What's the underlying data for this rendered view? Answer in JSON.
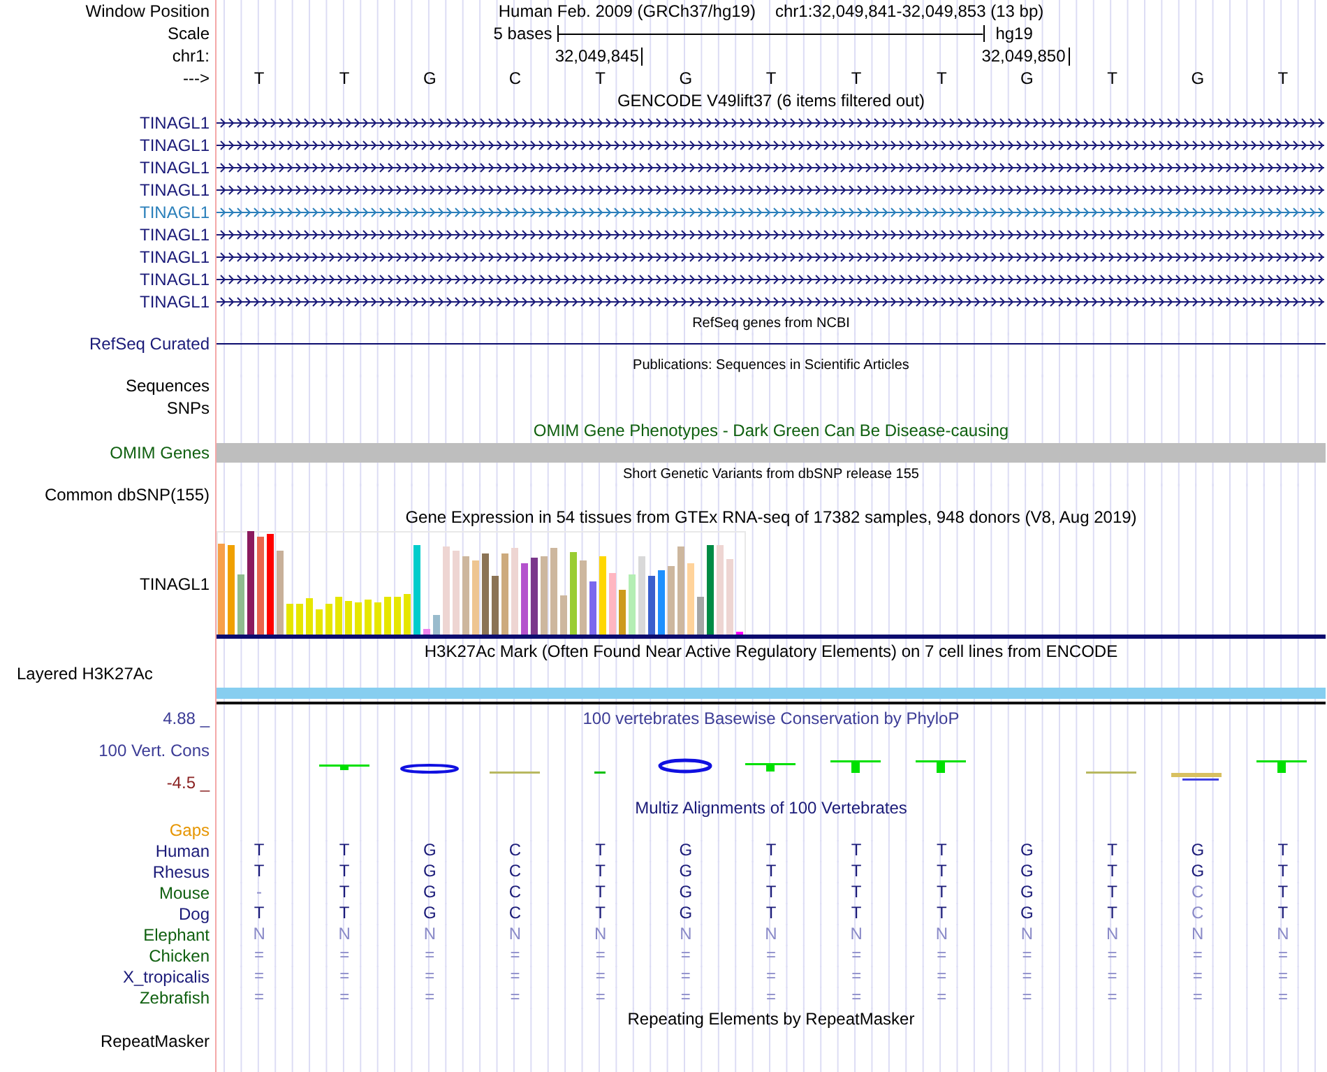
{
  "header": {
    "position_label": "Window Position",
    "assembly": "Human Feb. 2009 (GRCh37/hg19)",
    "range": "chr1:32,049,841-32,049,853 (13 bp)",
    "scale_label": "Scale",
    "scale_text": "5 bases",
    "scale_db": "hg19",
    "chrom_label": "chr1:",
    "ticks": [
      "32,049,845",
      "32,049,850"
    ],
    "strand_label": "--->",
    "bases": [
      "T",
      "T",
      "G",
      "C",
      "T",
      "G",
      "T",
      "T",
      "T",
      "G",
      "T",
      "G",
      "T"
    ]
  },
  "tracks": [
    {
      "kind": "gene",
      "title": "GENCODE V49lift37 (6 items filtered out)",
      "items": [
        {
          "label": "TINAGL1",
          "color": "#1a1a78"
        },
        {
          "label": "TINAGL1",
          "color": "#1a1a78"
        },
        {
          "label": "TINAGL1",
          "color": "#1a1a78"
        },
        {
          "label": "TINAGL1",
          "color": "#1a1a78"
        },
        {
          "label": "TINAGL1",
          "color": "#2a7fba"
        },
        {
          "label": "TINAGL1",
          "color": "#1a1a78"
        },
        {
          "label": "TINAGL1",
          "color": "#1a1a78"
        },
        {
          "label": "TINAGL1",
          "color": "#1a1a78"
        },
        {
          "label": "TINAGL1",
          "color": "#1a1a78"
        }
      ]
    },
    {
      "kind": "refseq",
      "title": "RefSeq genes from NCBI",
      "labels": [
        "RefSeq Curated"
      ]
    },
    {
      "kind": "empty",
      "title": "Publications: Sequences in Scientific Articles",
      "labels": [
        "Sequences",
        "SNPs"
      ]
    },
    {
      "kind": "omim",
      "title": "OMIM Gene Phenotypes - Dark Green Can Be Disease-causing",
      "labels": [
        "OMIM Genes"
      ]
    },
    {
      "kind": "empty",
      "title": "Short Genetic Variants from dbSNP release 155",
      "labels": [
        "Common dbSNP(155)"
      ]
    },
    {
      "kind": "gtex",
      "title": "Gene Expression in 54 tissues from GTEx RNA-seq of 17382 samples, 948 donors (V8, Aug 2019)",
      "labels": [
        "TINAGL1"
      ]
    },
    {
      "kind": "signal",
      "title": "H3K27Ac Mark (Often Found Near Active Regulatory Elements) on 7 cell lines from ENCODE",
      "labels": [
        "Layered H3K27Ac"
      ]
    },
    {
      "kind": "phylop",
      "title": "100 vertebrates Basewise Conservation by PhyloP",
      "labels": [
        "4.88 _",
        "100 Vert. Cons",
        "-4.5 _"
      ]
    },
    {
      "kind": "multiz",
      "title": "Multiz Alignments of 100 Vertebrates",
      "labels": [
        "Gaps"
      ],
      "species": [
        {
          "name": "Human",
          "color": "#1a1a78",
          "bases": [
            "T",
            "T",
            "G",
            "C",
            "T",
            "G",
            "T",
            "T",
            "T",
            "G",
            "T",
            "G",
            "T"
          ],
          "faded": [
            false,
            false,
            false,
            false,
            false,
            false,
            false,
            false,
            false,
            false,
            false,
            false,
            false
          ]
        },
        {
          "name": "Rhesus",
          "color": "#1a1a78",
          "bases": [
            "T",
            "T",
            "G",
            "C",
            "T",
            "G",
            "T",
            "T",
            "T",
            "G",
            "T",
            "G",
            "T"
          ],
          "faded": [
            false,
            false,
            false,
            false,
            false,
            false,
            false,
            false,
            false,
            false,
            false,
            false,
            false
          ]
        },
        {
          "name": "Mouse",
          "color": "#106010",
          "bases": [
            "-",
            "T",
            "G",
            "C",
            "T",
            "G",
            "T",
            "T",
            "T",
            "G",
            "T",
            "C",
            "T"
          ],
          "faded": [
            true,
            false,
            false,
            false,
            false,
            false,
            false,
            false,
            false,
            false,
            false,
            true,
            false
          ]
        },
        {
          "name": "Dog",
          "color": "#1a1a78",
          "bases": [
            "T",
            "T",
            "G",
            "C",
            "T",
            "G",
            "T",
            "T",
            "T",
            "G",
            "T",
            "C",
            "T"
          ],
          "faded": [
            false,
            false,
            false,
            false,
            false,
            false,
            false,
            false,
            false,
            false,
            false,
            true,
            false
          ]
        },
        {
          "name": "Elephant",
          "color": "#106010",
          "bases": [
            "N",
            "N",
            "N",
            "N",
            "N",
            "N",
            "N",
            "N",
            "N",
            "N",
            "N",
            "N",
            "N"
          ],
          "faded": [
            true,
            true,
            true,
            true,
            true,
            true,
            true,
            true,
            true,
            true,
            true,
            true,
            true
          ]
        },
        {
          "name": "Chicken",
          "color": "#106010",
          "bases": [
            "=",
            "=",
            "=",
            "=",
            "=",
            "=",
            "=",
            "=",
            "=",
            "=",
            "=",
            "=",
            "="
          ],
          "faded": [
            true,
            true,
            true,
            true,
            true,
            true,
            true,
            true,
            true,
            true,
            true,
            true,
            true
          ]
        },
        {
          "name": "X_tropicalis",
          "color": "#1a1a78",
          "bases": [
            "=",
            "=",
            "=",
            "=",
            "=",
            "=",
            "=",
            "=",
            "=",
            "=",
            "=",
            "=",
            "="
          ],
          "faded": [
            true,
            true,
            true,
            true,
            true,
            true,
            true,
            true,
            true,
            true,
            true,
            true,
            true
          ]
        },
        {
          "name": "Zebrafish",
          "color": "#106010",
          "bases": [
            "=",
            "=",
            "=",
            "=",
            "=",
            "=",
            "=",
            "=",
            "=",
            "=",
            "=",
            "=",
            "="
          ],
          "faded": [
            true,
            true,
            true,
            true,
            true,
            true,
            true,
            true,
            true,
            true,
            true,
            true,
            true
          ]
        }
      ]
    },
    {
      "kind": "empty",
      "title": "Repeating Elements by RepeatMasker",
      "labels": [
        "RepeatMasker"
      ]
    }
  ]
}
